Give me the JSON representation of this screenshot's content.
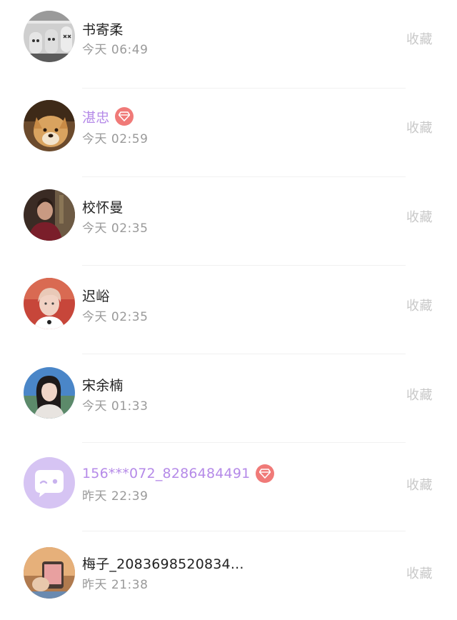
{
  "list": {
    "items": [
      {
        "name": "书寄柔",
        "time": "今天 06:49",
        "action": "收藏",
        "vip": false,
        "avatar": "grayscale-figures-avatar"
      },
      {
        "name": "湛忠",
        "time": "今天 02:59",
        "action": "收藏",
        "vip": true,
        "avatar": "dog-avatar"
      },
      {
        "name": "校怀曼",
        "time": "今天 02:35",
        "action": "收藏",
        "vip": false,
        "avatar": "woman-dark-photo-avatar"
      },
      {
        "name": "迟峪",
        "time": "今天 02:35",
        "action": "收藏",
        "vip": false,
        "avatar": "person-red-background-avatar"
      },
      {
        "name": "宋余楠",
        "time": "今天 01:33",
        "action": "收藏",
        "vip": false,
        "avatar": "woman-blue-background-avatar"
      },
      {
        "name": "156***072_8286484491",
        "time": "昨天 22:39",
        "action": "收藏",
        "vip": true,
        "avatar": "default-chat-bubble-avatar"
      },
      {
        "name": "梅子_2083698520834...",
        "time": "昨天 21:38",
        "action": "收藏",
        "vip": false,
        "avatar": "hand-phone-photo-avatar"
      }
    ]
  },
  "colors": {
    "vip_name": "#b58ae8",
    "vip_badge": "#f07a78",
    "name": "#222222",
    "time": "#9a9a9a",
    "action": "#c8c8c8"
  }
}
